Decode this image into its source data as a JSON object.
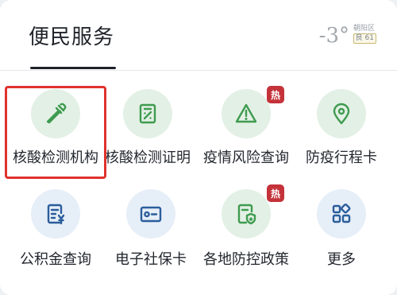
{
  "header": {
    "title": "便民服务",
    "temperature": "-3°",
    "district": "朝阳区",
    "air_quality": "良 61"
  },
  "services": [
    {
      "label": "核酸检测机构",
      "icon": "dropper-icon",
      "theme": "green",
      "hot": false
    },
    {
      "label": "核酸检测证明",
      "icon": "certificate-icon",
      "theme": "green",
      "hot": false
    },
    {
      "label": "疫情风险查询",
      "icon": "warning-icon",
      "theme": "green",
      "hot": true
    },
    {
      "label": "防疫行程卡",
      "icon": "location-pin-icon",
      "theme": "green",
      "hot": false
    },
    {
      "label": "公积金查询",
      "icon": "fund-document-icon",
      "theme": "blue",
      "hot": false
    },
    {
      "label": "电子社保卡",
      "icon": "id-card-icon",
      "theme": "blue",
      "hot": false
    },
    {
      "label": "各地防控政策",
      "icon": "shield-document-icon",
      "theme": "green",
      "hot": true
    },
    {
      "label": "更多",
      "icon": "grid-apps-icon",
      "theme": "blue",
      "hot": false
    }
  ],
  "badge_text": "热",
  "colors": {
    "green_icon": "#3e9b4f",
    "blue_icon": "#2b5d9b",
    "hot_badge": "#c4323a",
    "highlight_border": "#e0322d"
  }
}
